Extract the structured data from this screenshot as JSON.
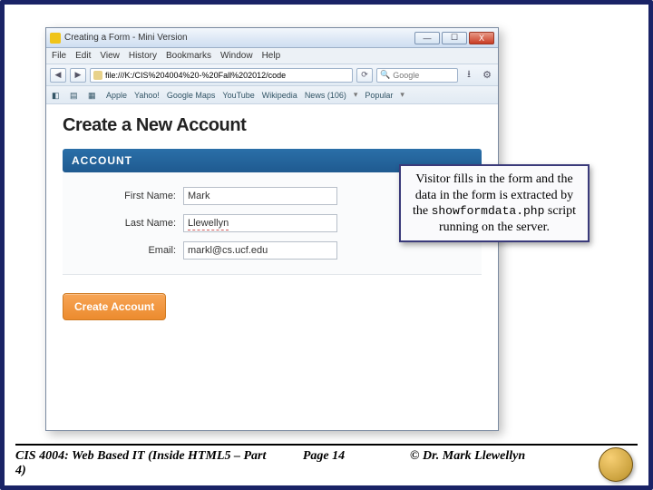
{
  "browser": {
    "title": "Creating a Form - Mini Version",
    "menus": [
      "File",
      "Edit",
      "View",
      "History",
      "Bookmarks",
      "Window",
      "Help"
    ],
    "url": "file:///K:/CIS%204004%20-%20Fall%202012/code",
    "search_placeholder": "Google",
    "bookmarks": [
      "Apple",
      "Yahoo!",
      "Google Maps",
      "YouTube",
      "Wikipedia",
      "News (106)",
      "Popular"
    ]
  },
  "page": {
    "heading": "Create a New Account",
    "section": "ACCOUNT",
    "fields": {
      "first_label": "First Name:",
      "first_value": "Mark",
      "last_label": "Last Name:",
      "last_value": "Llewellyn",
      "email_label": "Email:",
      "email_value": "markl@cs.ucf.edu"
    },
    "button": "Create Account"
  },
  "annotation": {
    "line1": "Visitor fills in the form and the data in the form is extracted by the ",
    "code": "showformdata.php",
    "line2": " script running on the server."
  },
  "footer": {
    "left": "CIS 4004: Web Based IT (Inside HTML5 – Part 4)",
    "center": "Page 14",
    "right": "© Dr. Mark Llewellyn"
  }
}
